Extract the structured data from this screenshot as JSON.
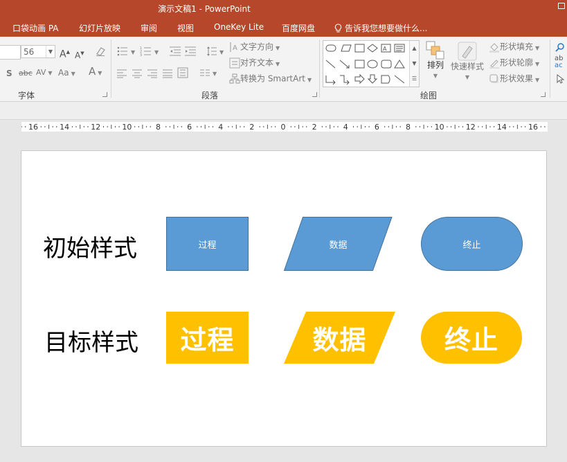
{
  "window": {
    "title": "演示文稿1 - PowerPoint"
  },
  "menu": {
    "tabs": [
      "口袋动画 PA",
      "幻灯片放映",
      "审阅",
      "视图",
      "OneKey Lite",
      "百度网盘"
    ],
    "tell_me": "告诉我您想要做什么..."
  },
  "ribbon": {
    "font": {
      "size_value": "56",
      "group_label": "字体",
      "grow_label": "A",
      "shrink_label": "A",
      "shadow_label": "S",
      "strike_label": "abc",
      "spacing_label": "AV",
      "case_label": "Aa",
      "color_label": "A"
    },
    "paragraph": {
      "group_label": "段落",
      "text_direction": "文字方向",
      "align_text": "对齐文本",
      "smartart": "转换为 SmartArt"
    },
    "drawing": {
      "group_label": "绘图",
      "arrange": "排列",
      "quick_styles": "快速样式",
      "shape_fill": "形状填充",
      "shape_outline": "形状轮廓",
      "shape_effects": "形状效果"
    },
    "editing": {
      "replace_hint": "ab"
    }
  },
  "ruler": {
    "labels": [
      "16",
      "14",
      "12",
      "10",
      "8",
      "6",
      "4",
      "2",
      "0",
      "2",
      "4",
      "6",
      "8",
      "10",
      "12",
      "14",
      "16"
    ]
  },
  "slide": {
    "row1_label": "初始样式",
    "row2_label": "目标样式",
    "initial": {
      "process": "过程",
      "data": "数据",
      "terminator": "终止"
    },
    "target": {
      "process": "过程",
      "data": "数据",
      "terminator": "终止"
    }
  },
  "colors": {
    "title_bar": "#b7472a",
    "initial_fill": "#5b9bd5",
    "initial_border": "#41719c",
    "target_fill": "#ffc000"
  }
}
